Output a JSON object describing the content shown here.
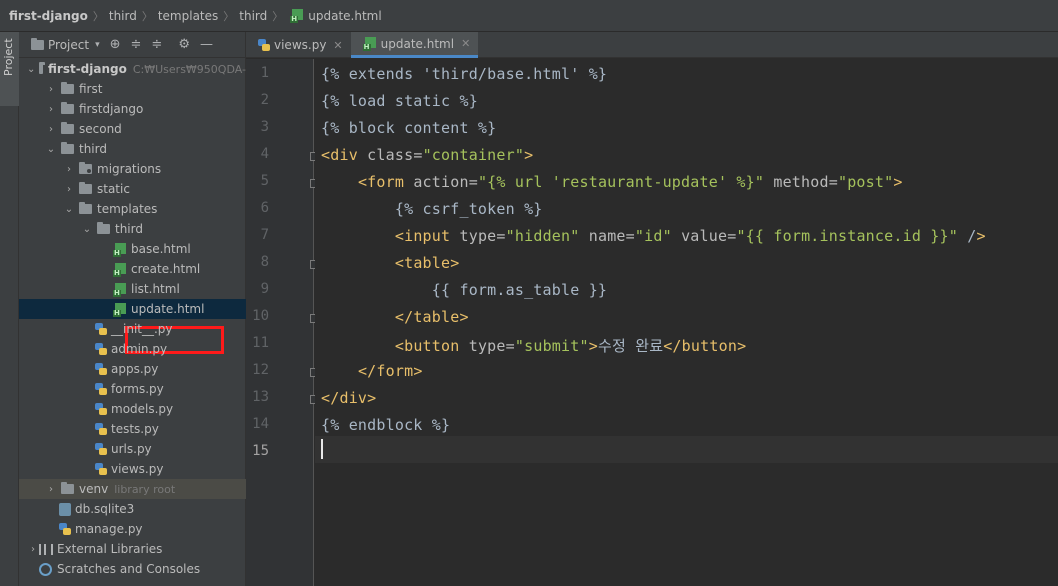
{
  "breadcrumb": [
    "first-django",
    "third",
    "templates",
    "third",
    "update.html"
  ],
  "project_panel": {
    "title": "Project",
    "root": {
      "name": "first-django",
      "path": "C:₩Users₩950QDA-"
    },
    "tree": [
      {
        "label": "first",
        "type": "folder",
        "level": 1,
        "expanded": false
      },
      {
        "label": "firstdjango",
        "type": "folder",
        "level": 1,
        "expanded": false
      },
      {
        "label": "second",
        "type": "folder",
        "level": 1,
        "expanded": false
      },
      {
        "label": "third",
        "type": "folder",
        "level": 1,
        "expanded": true
      },
      {
        "label": "migrations",
        "type": "folder",
        "level": 2,
        "expanded": false
      },
      {
        "label": "static",
        "type": "folder",
        "level": 2,
        "expanded": false
      },
      {
        "label": "templates",
        "type": "folder",
        "level": 2,
        "expanded": true
      },
      {
        "label": "third",
        "type": "folder",
        "level": 3,
        "expanded": true
      },
      {
        "label": "base.html",
        "type": "html",
        "level": 4
      },
      {
        "label": "create.html",
        "type": "html",
        "level": 4
      },
      {
        "label": "list.html",
        "type": "html",
        "level": 4
      },
      {
        "label": "update.html",
        "type": "html",
        "level": 4,
        "selected": true
      },
      {
        "label": "__init__.py",
        "type": "py",
        "level": 3
      },
      {
        "label": "admin.py",
        "type": "py",
        "level": 3
      },
      {
        "label": "apps.py",
        "type": "py",
        "level": 3
      },
      {
        "label": "forms.py",
        "type": "py",
        "level": 3
      },
      {
        "label": "models.py",
        "type": "py",
        "level": 3
      },
      {
        "label": "tests.py",
        "type": "py",
        "level": 3
      },
      {
        "label": "urls.py",
        "type": "py",
        "level": 3
      },
      {
        "label": "views.py",
        "type": "py",
        "level": 3
      },
      {
        "label": "venv",
        "type": "folder",
        "level": 1,
        "expanded": false,
        "hint": "library root"
      },
      {
        "label": "db.sqlite3",
        "type": "db",
        "level": 1
      },
      {
        "label": "manage.py",
        "type": "py",
        "level": 1
      },
      {
        "label": "External Libraries",
        "type": "lib",
        "level": 0,
        "expanded": false
      },
      {
        "label": "Scratches and Consoles",
        "type": "console",
        "level": 0
      }
    ]
  },
  "tool_window_tab": "Project",
  "tabs": [
    {
      "label": "views.py",
      "active": false
    },
    {
      "label": "update.html",
      "active": true
    }
  ],
  "editor": {
    "lines": [
      "{% extends 'third/base.html' %}",
      "{% load static %}",
      "{% block content %}",
      "<div class=\"container\">",
      "    <form action=\"{% url 'restaurant-update' %}\" method=\"post\">",
      "        {% csrf_token %}",
      "        <input type=\"hidden\" name=\"id\" value=\"{{ form.instance.id }}\" />",
      "        <table>",
      "            {{ form.as_table }}",
      "        </table>",
      "        <button type=\"submit\">수정 완료</button>",
      "    </form>",
      "</div>",
      "{% endblock %}",
      ""
    ],
    "current_line": 15
  },
  "colors": {
    "tag": "#e8bf6a",
    "string": "#a5c25c",
    "text": "#a9b7c6",
    "selection_box": "#ff1a1a"
  }
}
